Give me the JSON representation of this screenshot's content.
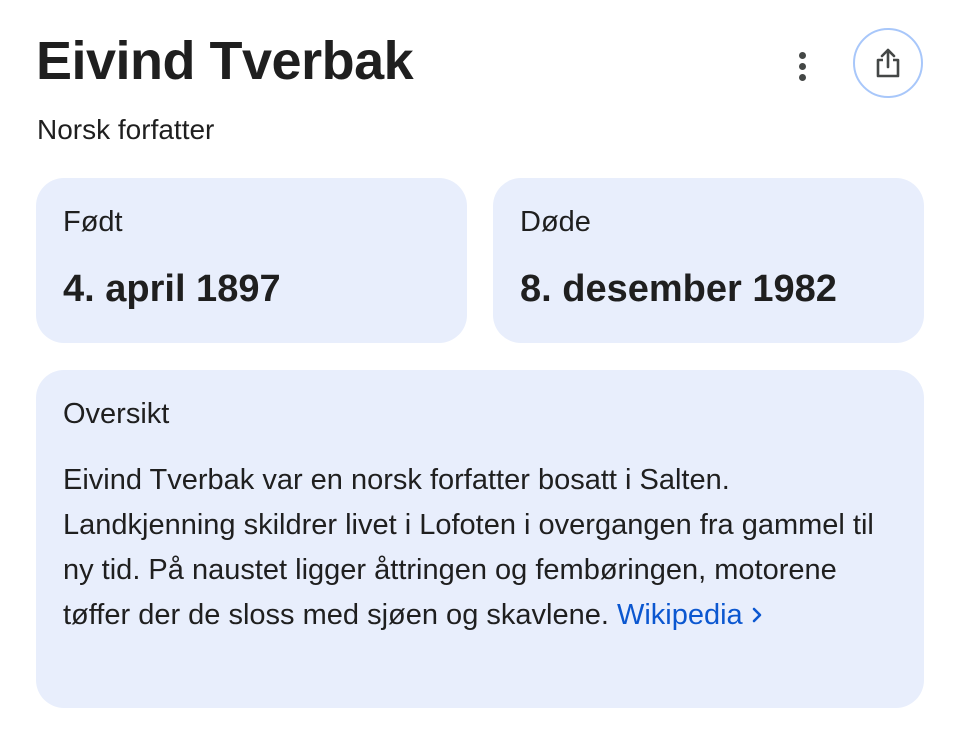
{
  "header": {
    "title": "Eivind Tverbak",
    "subtitle": "Norsk forfatter",
    "more_icon": "more-vert-icon",
    "share_icon": "share-icon"
  },
  "facts": {
    "born": {
      "label": "Født",
      "value": "4. april 1897"
    },
    "died": {
      "label": "Døde",
      "value": "8. desember 1982"
    }
  },
  "overview": {
    "title": "Oversikt",
    "text": "Eivind Tverbak var en norsk forfatter bosatt i Salten. Landkjenning skildrer livet i Lofoten i overgangen fra gammel til ny tid. På naustet ligger åttringen og fembøringen, motorene tøffer der de sloss med sjøen og skavlene.",
    "source_link": "Wikipedia",
    "chevron_icon": "chevron-right-icon"
  },
  "colors": {
    "card_background": "#e8eefc",
    "link": "#0b57d0",
    "share_border": "#a8c7fa",
    "text": "#1f1f1f"
  }
}
